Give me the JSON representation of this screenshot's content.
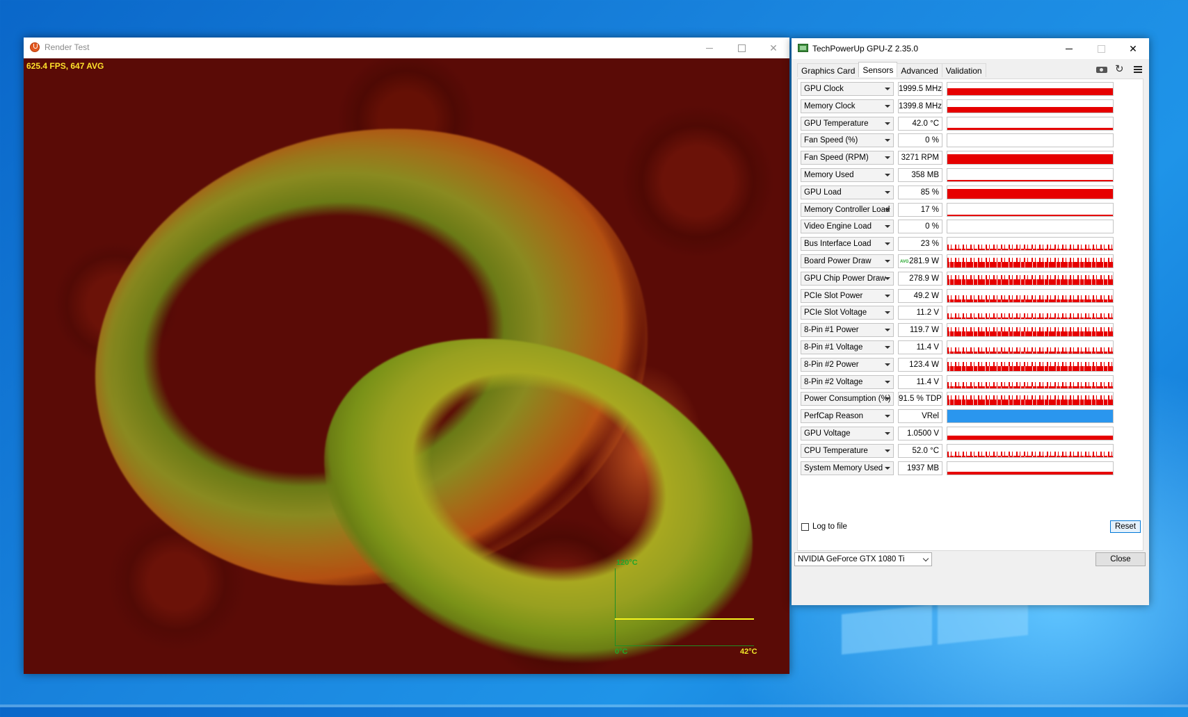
{
  "render_test": {
    "title": "Render Test",
    "fps_text": "625.4 FPS, 647 AVG",
    "temp_graph": {
      "max_label": "120°C",
      "min_label": "0°C",
      "current_label": "42°C",
      "current_fraction": 0.35
    }
  },
  "gpuz": {
    "title": "TechPowerUp GPU-Z 2.35.0",
    "tabs": [
      "Graphics Card",
      "Sensors",
      "Advanced",
      "Validation"
    ],
    "active_tab": "Sensors",
    "sensors": [
      {
        "name": "GPU Clock",
        "value": "1999.5 MHz",
        "level": 0.55,
        "style": "solid"
      },
      {
        "name": "Memory Clock",
        "value": "1399.8 MHz",
        "level": 0.45,
        "style": "solid"
      },
      {
        "name": "GPU Temperature",
        "value": "42.0 °C",
        "level": 0.18,
        "style": "solid"
      },
      {
        "name": "Fan Speed (%)",
        "value": "0 %",
        "level": 0.0,
        "style": "solid"
      },
      {
        "name": "Fan Speed (RPM)",
        "value": "3271 RPM",
        "level": 0.75,
        "style": "solid"
      },
      {
        "name": "Memory Used",
        "value": "358 MB",
        "level": 0.05,
        "style": "solid"
      },
      {
        "name": "GPU Load",
        "value": "85 %",
        "level": 0.75,
        "style": "solid"
      },
      {
        "name": "Memory Controller Load",
        "value": "17 %",
        "level": 0.12,
        "style": "solid"
      },
      {
        "name": "Video Engine Load",
        "value": "0 %",
        "level": 0.0,
        "style": "solid"
      },
      {
        "name": "Bus Interface Load",
        "value": "23 %",
        "level": 0.2,
        "style": "spiky"
      },
      {
        "name": "Board Power Draw",
        "value": "281.9 W",
        "avg": "AVG",
        "level": 0.65,
        "style": "spiky"
      },
      {
        "name": "GPU Chip Power Draw",
        "value": "278.9 W",
        "level": 0.65,
        "style": "spiky"
      },
      {
        "name": "PCIe Slot Power",
        "value": "49.2 W",
        "level": 0.45,
        "style": "spiky"
      },
      {
        "name": "PCIe Slot Voltage",
        "value": "11.2 V",
        "level": 0.35,
        "style": "spiky"
      },
      {
        "name": "8-Pin #1 Power",
        "value": "119.7 W",
        "level": 0.6,
        "style": "spiky"
      },
      {
        "name": "8-Pin #1 Voltage",
        "value": "11.4 V",
        "level": 0.4,
        "style": "spiky"
      },
      {
        "name": "8-Pin #2 Power",
        "value": "123.4 W",
        "level": 0.6,
        "style": "spiky"
      },
      {
        "name": "8-Pin #2 Voltage",
        "value": "11.4 V",
        "level": 0.4,
        "style": "spiky"
      },
      {
        "name": "Power Consumption (%)",
        "value": "91.5 % TDP",
        "level": 0.65,
        "style": "spiky"
      },
      {
        "name": "PerfCap Reason",
        "value": "VRel",
        "level": 1.0,
        "style": "blue"
      },
      {
        "name": "GPU Voltage",
        "value": "1.0500 V",
        "level": 0.35,
        "style": "solid"
      },
      {
        "name": "CPU Temperature",
        "value": "52.0 °C",
        "level": 0.25,
        "style": "spiky"
      },
      {
        "name": "System Memory Used",
        "value": "1937 MB",
        "level": 0.2,
        "style": "solid"
      }
    ],
    "log_to_file_label": "Log to file",
    "log_to_file_checked": false,
    "reset_label": "Reset",
    "gpu_select_value": "NVIDIA GeForce GTX 1080 Ti",
    "close_label": "Close",
    "colors": {
      "graph_red": "#e60000",
      "graph_blue": "#2a96ee"
    }
  }
}
